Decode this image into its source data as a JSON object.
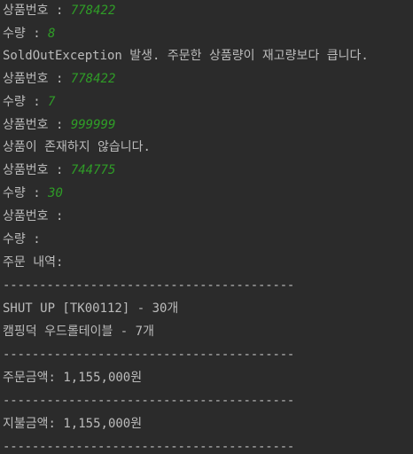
{
  "console": {
    "lines": [
      {
        "prompt": "상품번호 : ",
        "input": "778422"
      },
      {
        "prompt": "수량 : ",
        "input": "8"
      },
      {
        "text": "SoldOutException 발생. 주문한 상품량이 재고량보다 큽니다."
      },
      {
        "prompt": "상품번호 : ",
        "input": "778422"
      },
      {
        "prompt": "수량 : ",
        "input": "7"
      },
      {
        "prompt": "상품번호 : ",
        "input": "999999"
      },
      {
        "text": "상품이 존재하지 않습니다."
      },
      {
        "prompt": "상품번호 : ",
        "input": "744775"
      },
      {
        "prompt": "수량 : ",
        "input": "30"
      },
      {
        "prompt": "상품번호 : ",
        "input": ""
      },
      {
        "prompt": "수량 : ",
        "input": ""
      },
      {
        "text": "주문 내역:"
      },
      {
        "text": "----------------------------------------"
      },
      {
        "text": "SHUT UP [TK00112] - 30개"
      },
      {
        "text": "캠핑덕 우드롤테이블 - 7개"
      },
      {
        "text": "----------------------------------------"
      },
      {
        "text": "주문금액: 1,155,000원"
      },
      {
        "text": "----------------------------------------"
      },
      {
        "text": "지불금액: 1,155,000원"
      },
      {
        "text": "----------------------------------------"
      }
    ]
  }
}
